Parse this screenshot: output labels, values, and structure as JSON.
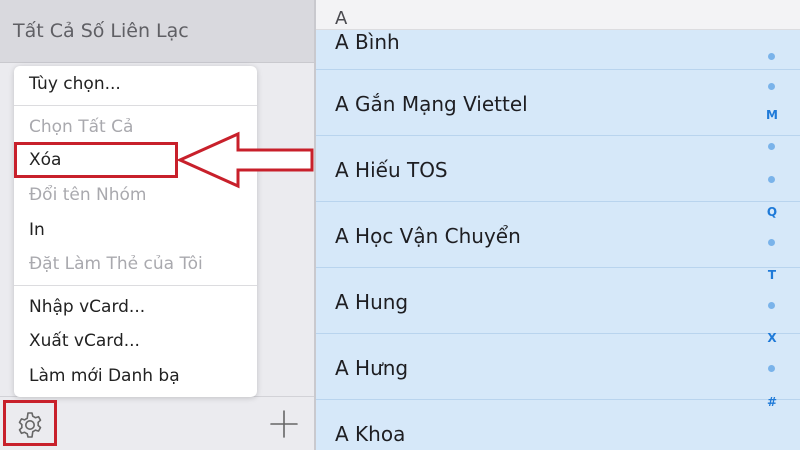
{
  "sidebar": {
    "title": "Tất Cả Số Liên Lạc"
  },
  "menu": {
    "items": [
      {
        "label": "Tùy chọn...",
        "enabled": true
      },
      {
        "label": "Chọn Tất Cả",
        "enabled": false
      },
      {
        "label": "Xóa",
        "enabled": true,
        "highlighted": true
      },
      {
        "label": "Đổi tên Nhóm",
        "enabled": false
      },
      {
        "label": "In",
        "enabled": true
      },
      {
        "label": "Đặt Làm Thẻ của Tôi",
        "enabled": false
      },
      {
        "label": "Nhập vCard...",
        "enabled": true
      },
      {
        "label": "Xuất vCard...",
        "enabled": true
      },
      {
        "label": "Làm mới Danh bạ",
        "enabled": true
      }
    ],
    "delete_key_icon": "delete-key-icon"
  },
  "toolbar": {
    "settings_icon": "gear-icon",
    "add_icon": "plus-icon"
  },
  "contacts": {
    "section": "A",
    "rows": [
      "A Bình",
      "A Gắn Mạng Viettel",
      "A Hiếu TOS",
      "A Học Vận Chuyển",
      "A Hung",
      "A Hưng",
      "A Khoa"
    ]
  },
  "index": {
    "letters": [
      "M",
      "Q",
      "T",
      "X",
      "#"
    ]
  },
  "colors": {
    "highlight_red": "#c8202b",
    "list_background": "#d6e8f9",
    "index_blue": "#1f7ad8"
  }
}
